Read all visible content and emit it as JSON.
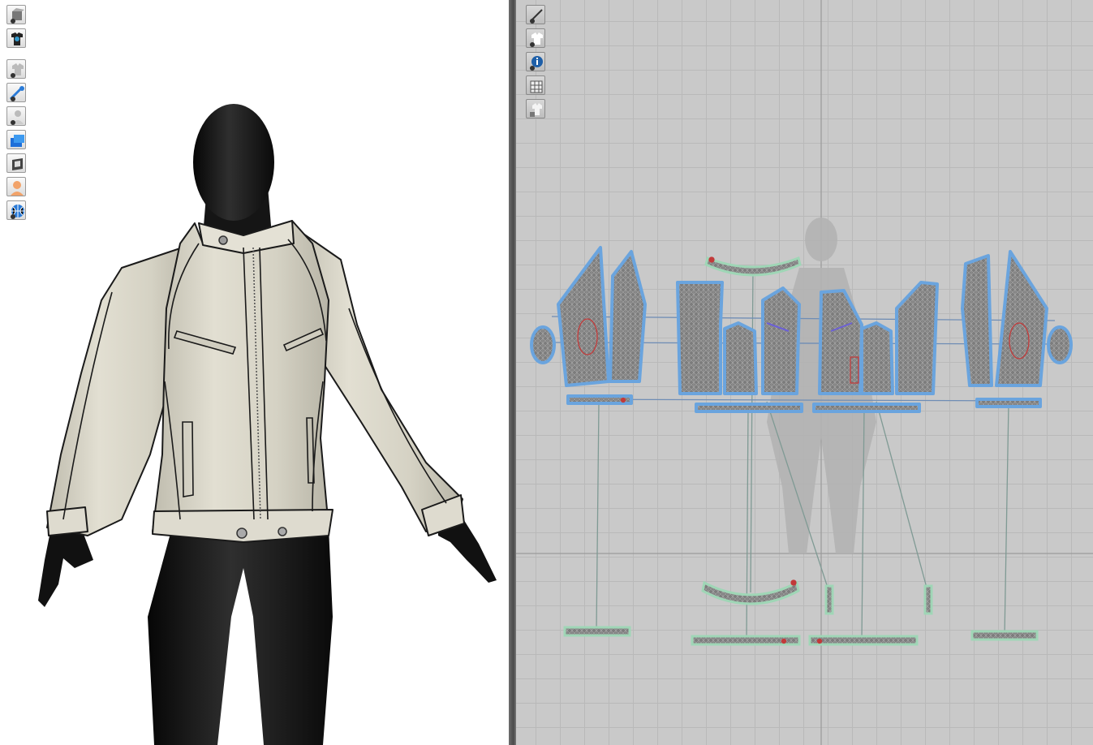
{
  "viewport3d": {
    "toolbar": [
      {
        "icon": "show-3d-garment-icon"
      },
      {
        "icon": "show-garment-avatar-icon"
      },
      {
        "icon": "show-garment-thick-icon"
      },
      {
        "icon": "show-pins-icon"
      },
      {
        "icon": "show-avatar-icon"
      },
      {
        "icon": "show-fabric-layers-icon"
      },
      {
        "icon": "show-texture-icon"
      },
      {
        "icon": "avatar-skin-icon"
      },
      {
        "icon": "show-mesh-icon"
      }
    ]
  },
  "viewport2d": {
    "toolbar": [
      {
        "icon": "show-2d-sewing-lines-icon"
      },
      {
        "icon": "show-2d-garment-icon"
      },
      {
        "icon": "pattern-info-icon"
      },
      {
        "icon": "show-2d-mesh-icon"
      },
      {
        "icon": "lock-pattern-icon"
      }
    ]
  },
  "colors": {
    "canvas_3d": "#ffffff",
    "canvas_2d": "#c9c9c9",
    "pattern_outline": "#6aa4de",
    "trim_outline": "#9fd6b6",
    "jacket_fabric": "#d9d6c8"
  }
}
